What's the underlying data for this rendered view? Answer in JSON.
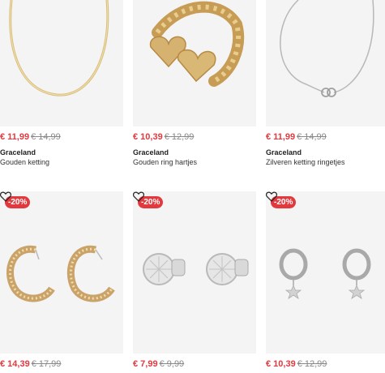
{
  "products": [
    {
      "price": "€ 11,99",
      "old_price": "€ 14,99",
      "brand": "Graceland",
      "name": "Gouden ketting",
      "badge": "",
      "icon": "gold-chain-necklace"
    },
    {
      "price": "€ 10,39",
      "old_price": "€ 12,99",
      "brand": "Graceland",
      "name": "Gouden ring hartjes",
      "badge": "",
      "icon": "gold-heart-ring"
    },
    {
      "price": "€ 11,99",
      "old_price": "€ 14,99",
      "brand": "Graceland",
      "name": "Zilveren ketting ringetjes",
      "badge": "",
      "icon": "silver-rings-necklace"
    },
    {
      "price": "€ 14,39",
      "old_price": "€ 17,99",
      "brand": "",
      "name": "",
      "badge": "-20%",
      "icon": "gold-hoop-earrings"
    },
    {
      "price": "€ 7,99",
      "old_price": "€ 9,99",
      "brand": "",
      "name": "",
      "badge": "-20%",
      "icon": "silver-stud-earrings"
    },
    {
      "price": "€ 10,39",
      "old_price": "€ 12,99",
      "brand": "",
      "name": "",
      "badge": "-20%",
      "icon": "silver-star-hoop-earrings"
    }
  ],
  "colors": {
    "sale": "#e2393f",
    "image_bg": "#f4f4f4"
  }
}
